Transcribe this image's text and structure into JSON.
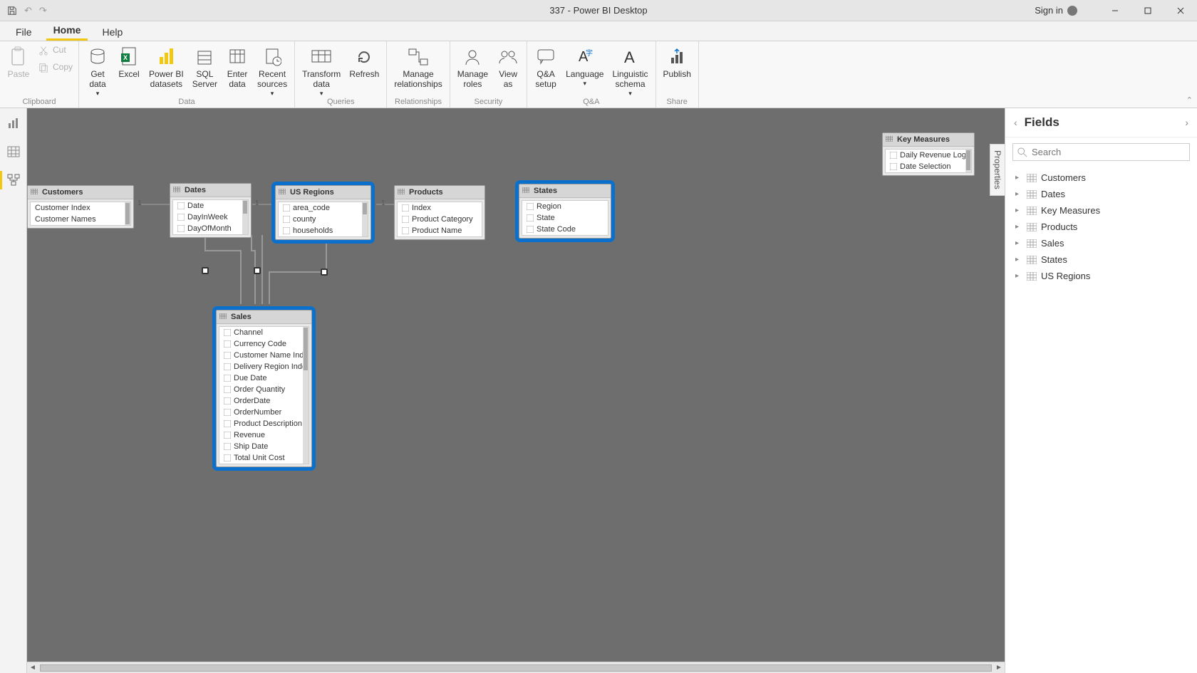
{
  "titlebar": {
    "title": "337 - Power BI Desktop",
    "signin": "Sign in"
  },
  "menu": {
    "file": "File",
    "home": "Home",
    "help": "Help"
  },
  "ribbon": {
    "clipboard": {
      "paste": "Paste",
      "cut": "Cut",
      "copy": "Copy",
      "caption": "Clipboard"
    },
    "data": {
      "get": "Get\ndata",
      "excel": "Excel",
      "pbi": "Power BI\ndatasets",
      "sql": "SQL\nServer",
      "enter": "Enter\ndata",
      "recent": "Recent\nsources",
      "caption": "Data"
    },
    "queries": {
      "transform": "Transform\ndata",
      "refresh": "Refresh",
      "caption": "Queries"
    },
    "relationships": {
      "manage": "Manage\nrelationships",
      "caption": "Relationships"
    },
    "security": {
      "roles": "Manage\nroles",
      "view": "View\nas",
      "caption": "Security"
    },
    "qa": {
      "setup": "Q&A\nsetup",
      "lang": "Language",
      "ling": "Linguistic\nschema",
      "caption": "Q&A"
    },
    "share": {
      "publish": "Publish",
      "caption": "Share"
    }
  },
  "tables": {
    "customers": {
      "title": "Customers",
      "fields": [
        "Customer Index",
        "Customer Names"
      ]
    },
    "dates": {
      "title": "Dates",
      "fields": [
        "Date",
        "DayInWeek",
        "DayOfMonth"
      ]
    },
    "usregions": {
      "title": "US Regions",
      "fields": [
        "area_code",
        "county",
        "households"
      ]
    },
    "products": {
      "title": "Products",
      "fields": [
        "Index",
        "Product Category",
        "Product Name"
      ]
    },
    "states": {
      "title": "States",
      "fields": [
        "Region",
        "State",
        "State Code"
      ]
    },
    "sales": {
      "title": "Sales",
      "fields": [
        "Channel",
        "Currency Code",
        "Customer Name Index",
        "Delivery Region Index",
        "Due Date",
        "Order Quantity",
        "OrderDate",
        "OrderNumber",
        "Product Description I...",
        "Revenue",
        "Ship Date",
        "Total Unit Cost"
      ]
    },
    "keymeasures": {
      "title": "Key Measures",
      "fields": [
        "Daily Revenue Logic",
        "Date Selection"
      ]
    }
  },
  "cardinality": {
    "one": "1"
  },
  "fieldsPane": {
    "title": "Fields",
    "searchPlaceholder": "Search",
    "tables": [
      "Customers",
      "Dates",
      "Key Measures",
      "Products",
      "Sales",
      "States",
      "US Regions"
    ]
  },
  "propertiesTab": "Properties"
}
